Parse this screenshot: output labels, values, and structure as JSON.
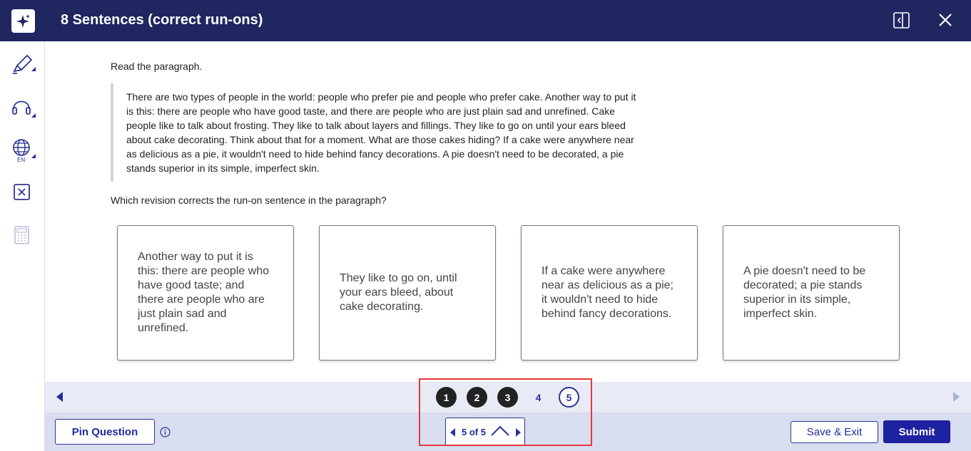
{
  "header": {
    "title": "8 Sentences (correct run-ons)",
    "logo_icon": "sparkle-icon",
    "collapse_icon": "collapse-panel-icon",
    "close_icon": "close-icon"
  },
  "sidebar": {
    "tools": [
      {
        "name": "highlighter-icon"
      },
      {
        "name": "headphones-icon"
      },
      {
        "name": "globe-icon",
        "label": "EN"
      },
      {
        "name": "eliminator-icon"
      },
      {
        "name": "calculator-icon"
      }
    ]
  },
  "content": {
    "prompt": "Read the paragraph.",
    "passage_lines": [
      "There are two types of people in the world: people who prefer pie and people who prefer cake. Another way to put it",
      "is this: there are people who have good taste, and there are people who are just plain sad and unrefined. Cake",
      "people like to talk about frosting. They like to talk about layers and fillings. They like to go on until your ears bleed",
      "about cake decorating. Think about that for a moment. What are those cakes hiding? If a cake were anywhere near",
      "as delicious as a pie, it wouldn't need to hide behind fancy decorations. A pie doesn't need to be decorated, a pie",
      "stands superior in its simple, imperfect skin."
    ],
    "question": "Which revision corrects the run-on sentence in the paragraph?",
    "choices": [
      "Another way to put it is this: there are people who have good taste; and there are people who are just plain sad and unrefined.",
      "They like to go on, until your ears bleed, about cake decorating.",
      "If a cake were anywhere near as delicious as a pie; it wouldn't need to hide behind fancy decorations.",
      "A pie doesn't need to be decorated; a pie stands superior in its simple, imperfect skin."
    ]
  },
  "navigation": {
    "questions": [
      {
        "label": "1",
        "state": "answered"
      },
      {
        "label": "2",
        "state": "answered"
      },
      {
        "label": "3",
        "state": "answered"
      },
      {
        "label": "4",
        "state": "unanswered"
      },
      {
        "label": "5",
        "state": "current"
      }
    ],
    "pager_label": "5 of 5"
  },
  "footer": {
    "pin_label": "Pin Question",
    "save_label": "Save & Exit",
    "submit_label": "Submit"
  },
  "colors": {
    "header_bg": "#1f2660",
    "accent": "#1d22a0",
    "nav_bg": "#e8ebf5",
    "footer_bg": "#d8ddef",
    "highlight": "#e5383b"
  }
}
